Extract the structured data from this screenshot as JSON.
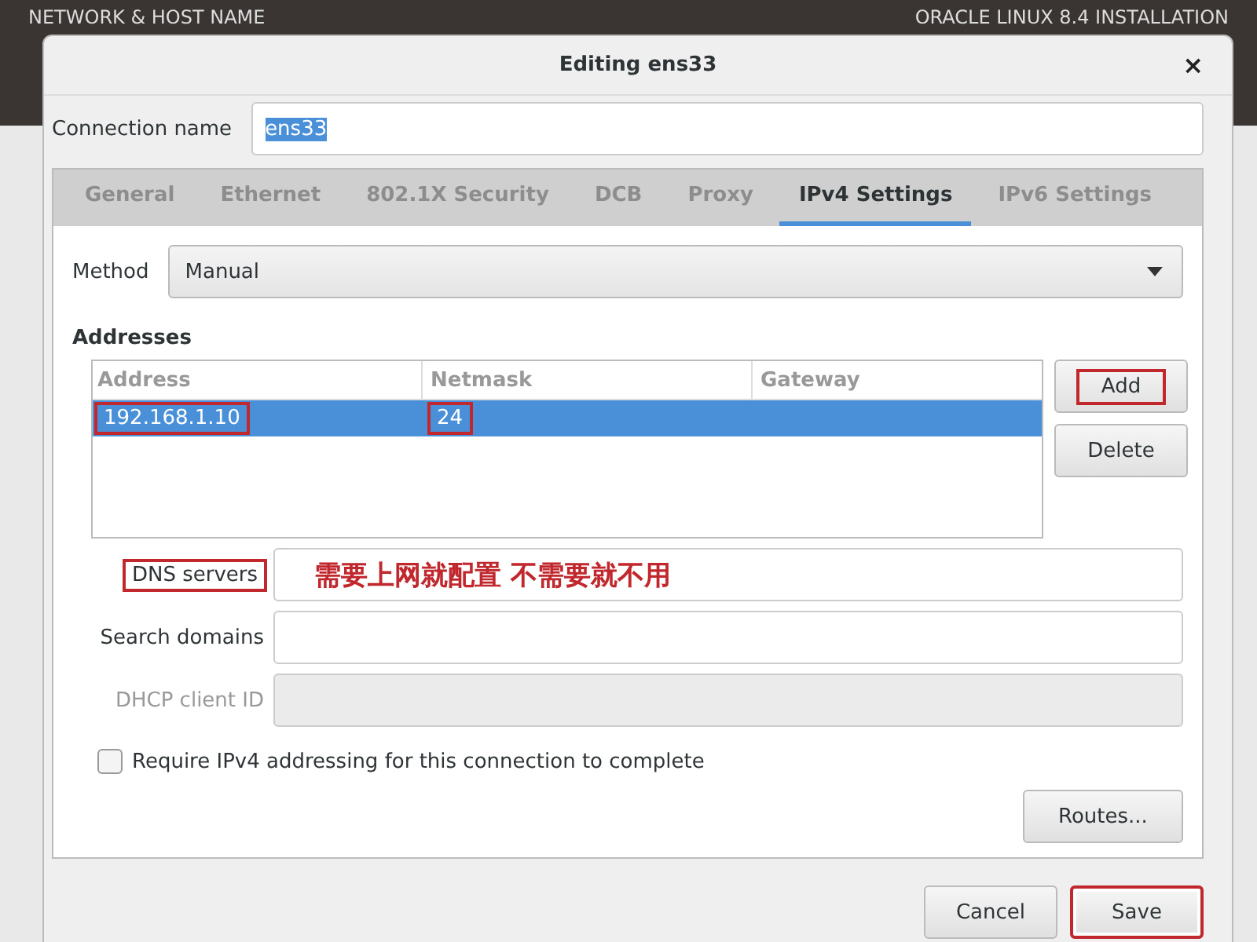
{
  "backdrop": {
    "title": "NETWORK & HOST NAME",
    "product": "ORACLE LINUX 8.4 INSTALLATION"
  },
  "dialog": {
    "title": "Editing ens33",
    "close": "×"
  },
  "connection_name": {
    "label": "Connection name",
    "value": "ens33",
    "text_selected": true
  },
  "tabs": [
    {
      "label": "General",
      "selected": false
    },
    {
      "label": "Ethernet",
      "selected": false
    },
    {
      "label": "802.1X Security",
      "selected": false
    },
    {
      "label": "DCB",
      "selected": false
    },
    {
      "label": "Proxy",
      "selected": false
    },
    {
      "label": "IPv4 Settings",
      "selected": true
    },
    {
      "label": "IPv6 Settings",
      "selected": false
    }
  ],
  "method": {
    "label": "Method",
    "value": "Manual"
  },
  "addresses": {
    "heading": "Addresses",
    "columns": [
      "Address",
      "Netmask",
      "Gateway"
    ],
    "rows": [
      {
        "selected": true,
        "cells": [
          {
            "text": "192.168.1.10",
            "annotated": true
          },
          {
            "text": "24",
            "annotated": true
          }
        ]
      }
    ],
    "buttons": [
      {
        "label": "Add",
        "annotated": true
      },
      {
        "label": "Delete",
        "annotated": false
      }
    ]
  },
  "fields": [
    {
      "label": "DNS servers",
      "annotated": true,
      "disabled": false,
      "annotation": "需要上网就配置 不需要就不用"
    },
    {
      "label": "Search domains",
      "annotated": false,
      "disabled": false
    },
    {
      "label": "DHCP client ID",
      "annotated": false,
      "disabled": true
    }
  ],
  "require_checkbox": {
    "label": "Require IPv4 addressing for this connection to complete",
    "checked": false
  },
  "routes_button": "Routes...",
  "footer_buttons": [
    {
      "label": "Cancel",
      "annotated": false
    },
    {
      "label": "Save",
      "annotated": true
    }
  ]
}
